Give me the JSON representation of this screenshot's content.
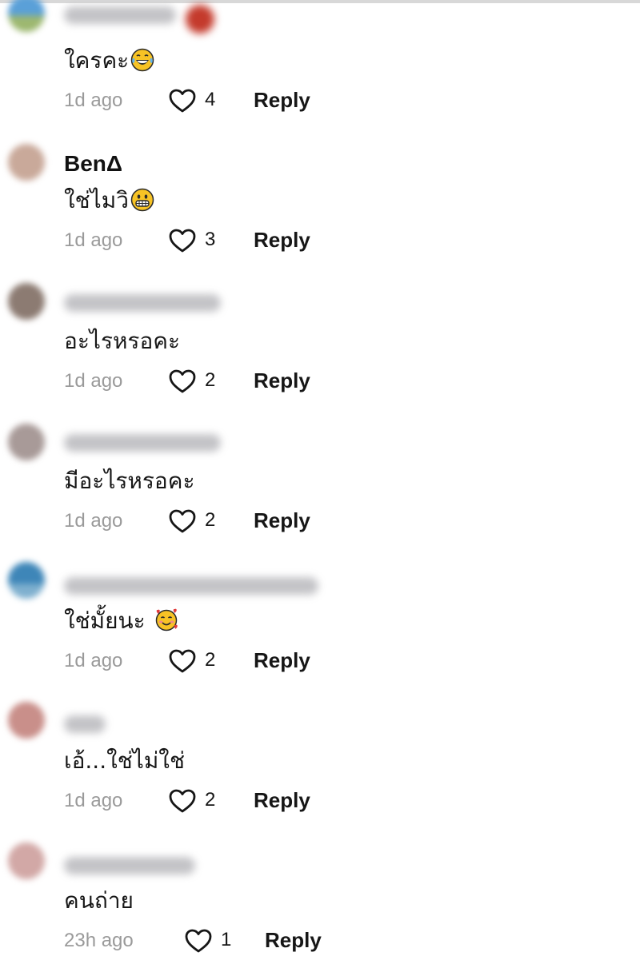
{
  "comments": [
    {
      "username": "",
      "text": "ใครคะ",
      "emoji": "tears-of-joy-emoji",
      "time": "1d ago",
      "likes": "4",
      "reply": "Reply",
      "avatar_color": "#5aa0d8"
    },
    {
      "username": "BenΔ",
      "text": "ใช่ไมวิ",
      "emoji": "grinning-emoji",
      "time": "1d ago",
      "likes": "3",
      "reply": "Reply",
      "avatar_color": "#c9a99a"
    },
    {
      "username": "",
      "text": "อะไรหรอคะ",
      "emoji": "",
      "time": "1d ago",
      "likes": "2",
      "reply": "Reply",
      "avatar_color": "#8c7b72"
    },
    {
      "username": "",
      "text": "มีอะไรหรอคะ",
      "emoji": "",
      "time": "1d ago",
      "likes": "2",
      "reply": "Reply",
      "avatar_color": "#a89a98"
    },
    {
      "username": "",
      "text": "ใช่มั้ยนะ ",
      "emoji": "smiling-hearts-emoji",
      "time": "1d ago",
      "likes": "2",
      "reply": "Reply",
      "avatar_color": "#3e86b8"
    },
    {
      "username": "",
      "text": "เอ้...ใช่ไม่ใช่",
      "emoji": "",
      "time": "1d ago",
      "likes": "2",
      "reply": "Reply",
      "avatar_color": "#c98f8a"
    },
    {
      "username": "",
      "text": "คนถ่าย",
      "emoji": "",
      "time": "23h ago",
      "likes": "1",
      "reply": "Reply",
      "avatar_color": "#d2a8a6"
    }
  ],
  "colors": {
    "text": "#161616",
    "muted": "#9a9a9a",
    "emoji_yellow": "#f7c325"
  }
}
